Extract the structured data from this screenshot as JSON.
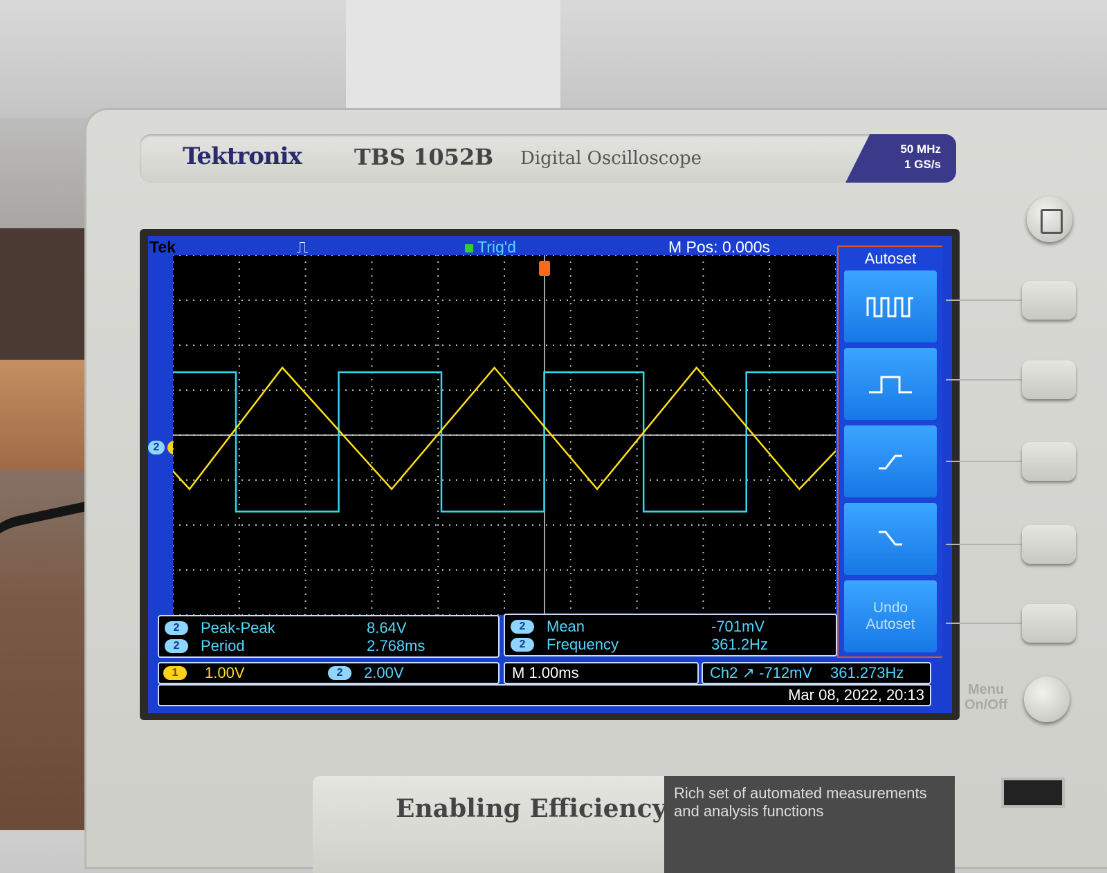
{
  "scope": {
    "brand": "Tektronix",
    "model": "TBS 1052B",
    "subtitle": "Digital Oscilloscope",
    "spec_bandwidth": "50 MHz",
    "spec_sample": "1 GS/s",
    "tagline": "Enabling Efficiency",
    "feature_text": "Rich set of automated measurements and analysis functions",
    "menu_onoff_label_1": "Menu",
    "menu_onoff_label_2": "On/Off"
  },
  "screen": {
    "topbar": {
      "logo": "Tek",
      "trigger_status": "Trig'd",
      "m_pos": "M Pos: 0.000s"
    },
    "autoset_menu": {
      "title": "Autoset",
      "buttons": [
        {
          "icon": "multi-cycle-square-icon"
        },
        {
          "icon": "single-cycle-square-icon"
        },
        {
          "icon": "rising-edge-icon"
        },
        {
          "icon": "falling-edge-icon"
        }
      ],
      "undo_line1": "Undo",
      "undo_line2": "Autoset"
    },
    "measurements_left": [
      {
        "channel": "2",
        "label": "Peak-Peak",
        "value": "8.64V"
      },
      {
        "channel": "2",
        "label": "Period",
        "value": "2.768ms"
      }
    ],
    "measurements_right": [
      {
        "channel": "2",
        "label": "Mean",
        "value": "-701mV"
      },
      {
        "channel": "2",
        "label": "Frequency",
        "value": "361.2Hz"
      }
    ],
    "status": {
      "ch1_badge": "1",
      "ch1_scale": "1.00V",
      "ch2_badge": "2",
      "ch2_scale": "2.00V",
      "timebase": "M 1.00ms",
      "trigger": "Ch2 ↗ -712mV",
      "trigger_freq": "361.273Hz",
      "datetime": "Mar 08, 2022, 20:13"
    },
    "ground_markers": [
      "2",
      "1"
    ]
  },
  "chart_data": {
    "type": "line",
    "title": "",
    "xlabel": "",
    "ylabel": "",
    "divisions_x": 10,
    "divisions_y": 8,
    "x_units": "divisions",
    "y_units": "divisions from center",
    "series": [
      {
        "color": "#33d7f0",
        "style": "square",
        "points": [
          [
            0,
            1.4
          ],
          [
            0.95,
            1.4
          ],
          [
            0.95,
            -1.7
          ],
          [
            2.5,
            -1.7
          ],
          [
            2.5,
            1.4
          ],
          [
            4.05,
            1.4
          ],
          [
            4.05,
            -1.7
          ],
          [
            5.6,
            -1.7
          ],
          [
            5.6,
            1.4
          ],
          [
            7.1,
            1.4
          ],
          [
            7.1,
            -1.7
          ],
          [
            8.65,
            -1.7
          ],
          [
            8.65,
            1.4
          ],
          [
            10,
            1.4
          ]
        ]
      },
      {
        "color": "#ffe01a",
        "style": "triangle",
        "points": [
          [
            0,
            -0.8
          ],
          [
            0.25,
            -1.2
          ],
          [
            1.65,
            1.5
          ],
          [
            3.3,
            -1.2
          ],
          [
            4.85,
            1.5
          ],
          [
            6.4,
            -1.2
          ],
          [
            7.9,
            1.5
          ],
          [
            9.45,
            -1.2
          ],
          [
            10,
            -0.35
          ]
        ]
      }
    ]
  }
}
